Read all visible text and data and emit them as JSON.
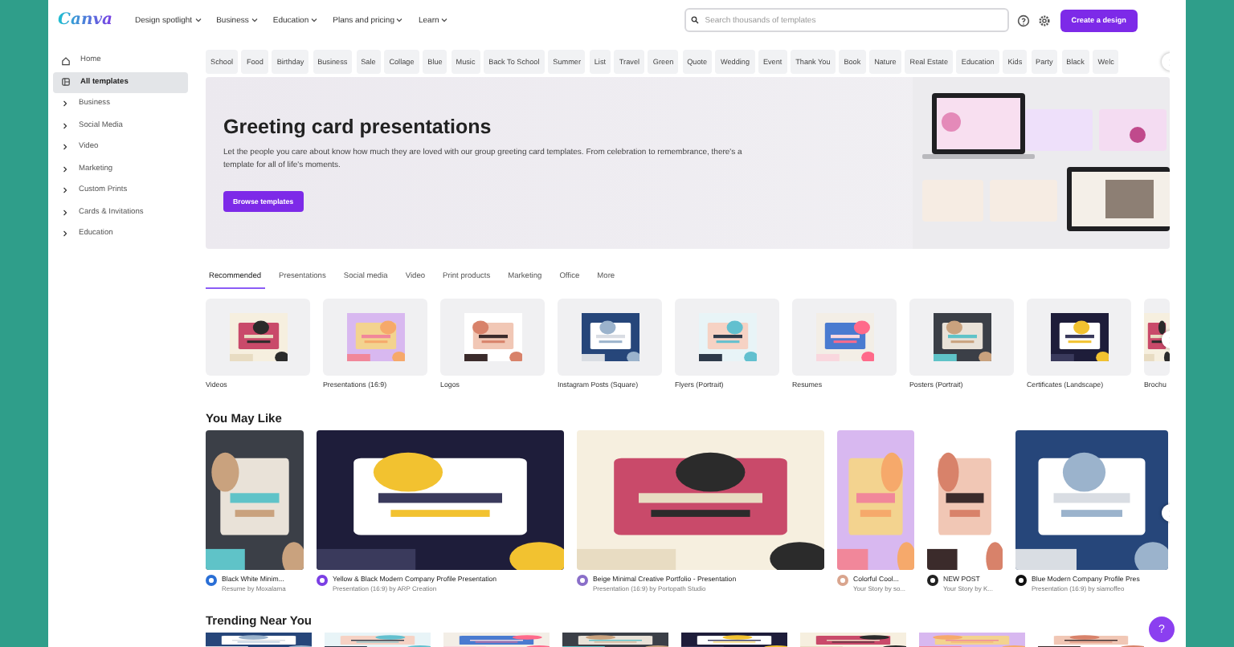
{
  "nav": {
    "logo": "Canva",
    "menu": [
      {
        "label": "Design spotlight"
      },
      {
        "label": "Business"
      },
      {
        "label": "Education"
      },
      {
        "label": "Plans and pricing"
      },
      {
        "label": "Learn"
      }
    ],
    "search": {
      "placeholder": "Search thousands of templates"
    },
    "create_button": "Create a design"
  },
  "sidebar": {
    "items": [
      {
        "label": "Home",
        "kind": "home",
        "selected": false
      },
      {
        "label": "All templates",
        "kind": "templates",
        "selected": true
      },
      {
        "label": "Business",
        "kind": "group",
        "selected": false
      },
      {
        "label": "Social Media",
        "kind": "group",
        "selected": false
      },
      {
        "label": "Video",
        "kind": "group",
        "selected": false
      },
      {
        "label": "Marketing",
        "kind": "group",
        "selected": false
      },
      {
        "label": "Custom Prints",
        "kind": "group",
        "selected": false
      },
      {
        "label": "Cards & Invitations",
        "kind": "group",
        "selected": false
      },
      {
        "label": "Education",
        "kind": "group",
        "selected": false
      }
    ]
  },
  "chips": [
    "School",
    "Food",
    "Birthday",
    "Business",
    "Sale",
    "Collage",
    "Blue",
    "Music",
    "Back To School",
    "Summer",
    "List",
    "Travel",
    "Green",
    "Quote",
    "Wedding",
    "Event",
    "Thank You",
    "Book",
    "Nature",
    "Real Estate",
    "Education",
    "Kids",
    "Party",
    "Black",
    "Welc"
  ],
  "hero": {
    "title": "Greeting card presentations",
    "description": "Let the people you care about know how much they are loved with our group greeting card templates. From celebration to remembrance, there's a template for all of life's moments.",
    "button": "Browse templates"
  },
  "tabs": [
    {
      "label": "Recommended",
      "selected": true
    },
    {
      "label": "Presentations",
      "selected": false
    },
    {
      "label": "Social media",
      "selected": false
    },
    {
      "label": "Video",
      "selected": false
    },
    {
      "label": "Print products",
      "selected": false
    },
    {
      "label": "Marketing",
      "selected": false
    },
    {
      "label": "Office",
      "selected": false
    },
    {
      "label": "More",
      "selected": false
    }
  ],
  "categories": [
    {
      "label": "Videos"
    },
    {
      "label": "Presentations (16:9)"
    },
    {
      "label": "Logos"
    },
    {
      "label": "Instagram Posts (Square)"
    },
    {
      "label": "Flyers (Portrait)"
    },
    {
      "label": "Resumes"
    },
    {
      "label": "Posters (Portrait)"
    },
    {
      "label": "Certificates (Landscape)"
    },
    {
      "label": "Brochu"
    }
  ],
  "you_may_like": {
    "heading": "You May Like",
    "cards": [
      {
        "title": "Black White Minim...",
        "subtitle": "Resume by Moxalama"
      },
      {
        "title": "Yellow & Black Modern Company Profile Presentation",
        "subtitle": "Presentation (16:9) by ARP Creation"
      },
      {
        "title": "Beige Minimal Creative Portfolio - Presentation",
        "subtitle": "Presentation (16:9) by Portopath Studio"
      },
      {
        "title": "Colorful Cool...",
        "subtitle": "Your Story by so..."
      },
      {
        "title": "NEW POST",
        "subtitle": "Your Story by K..."
      },
      {
        "title": "Blue Modern Company Profile Pres",
        "subtitle": "Presentation (16:9) by siamoffeo"
      }
    ]
  },
  "trending": {
    "heading": "Trending Near You"
  },
  "help_button": "?"
}
